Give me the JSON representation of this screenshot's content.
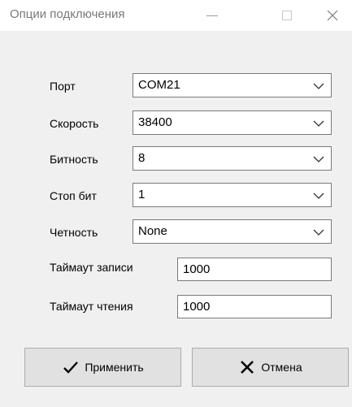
{
  "window": {
    "title": "Опции подключения"
  },
  "form": {
    "port": {
      "label": "Порт",
      "value": "COM21"
    },
    "speed": {
      "label": "Скорость",
      "value": "38400"
    },
    "bits": {
      "label": "Битность",
      "value": "8"
    },
    "stopbits": {
      "label": "Стоп бит",
      "value": "1"
    },
    "parity": {
      "label": "Четность",
      "value": "None"
    },
    "write_timeout": {
      "label": "Таймаут записи",
      "value": "1000"
    },
    "read_timeout": {
      "label": "Таймаут чтения",
      "value": "1000"
    }
  },
  "buttons": {
    "apply": "Применить",
    "cancel": "Отмена"
  },
  "icons": {
    "apply": "checkmark-icon",
    "cancel": "close-x-icon"
  }
}
